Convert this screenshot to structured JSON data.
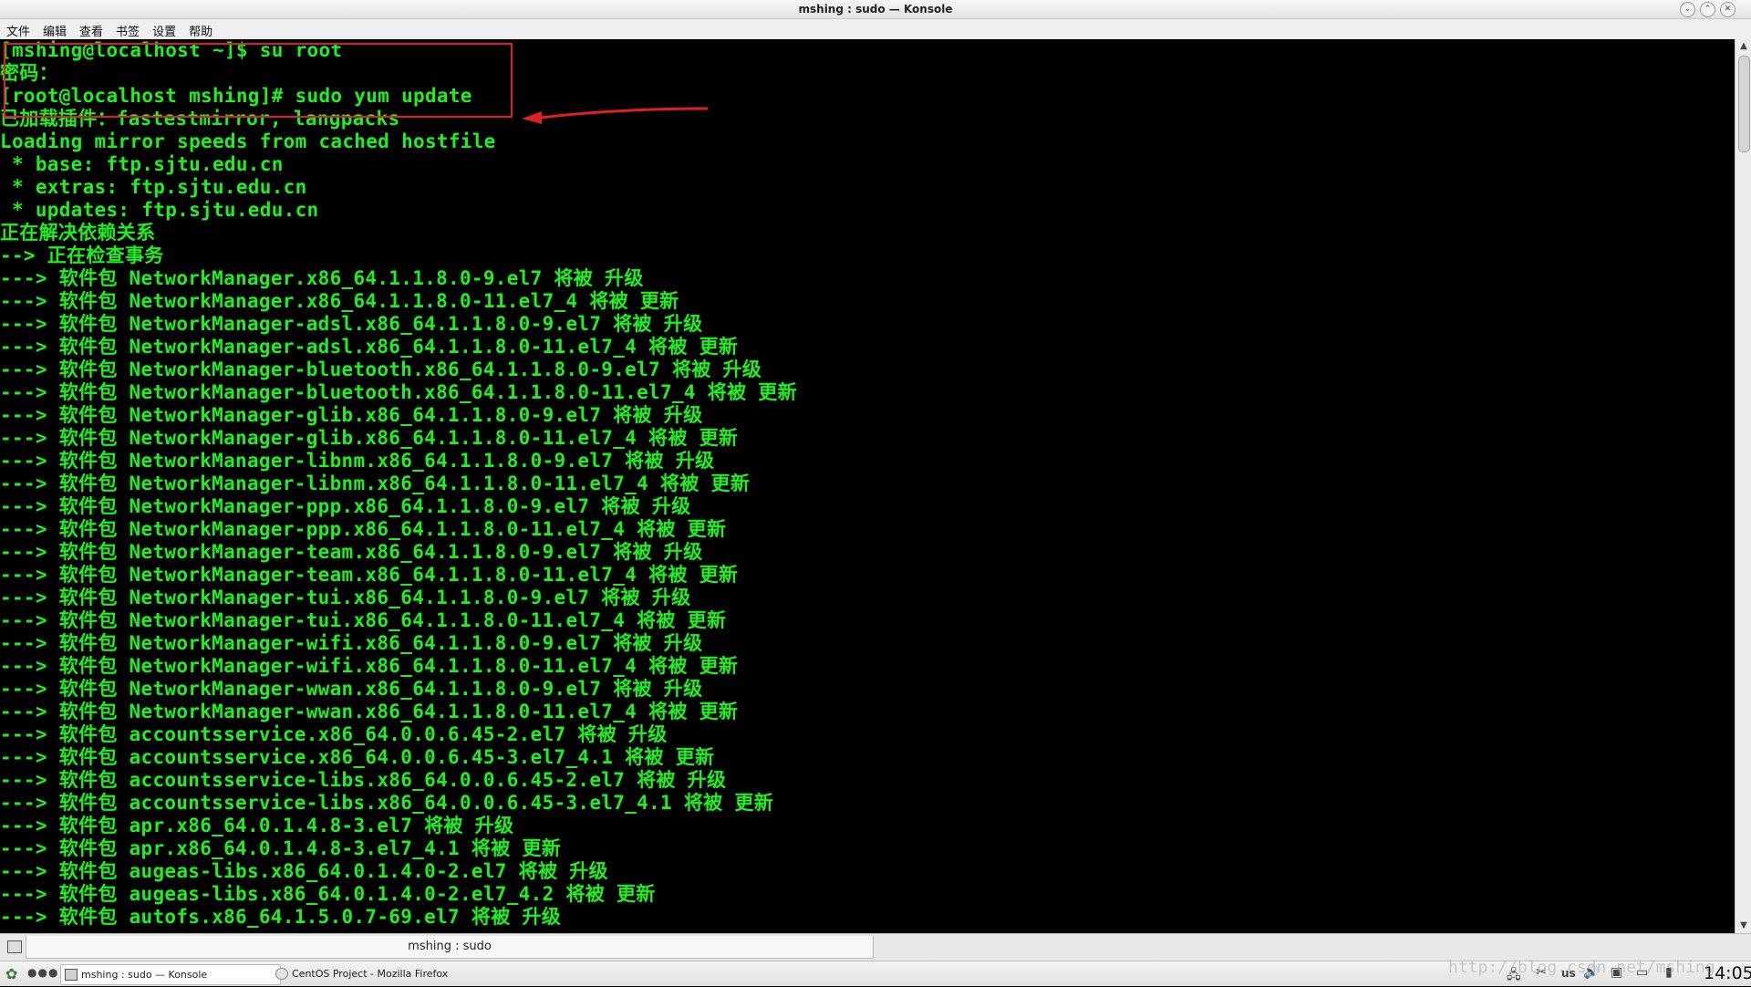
{
  "window": {
    "title": "mshing : sudo — Konsole",
    "buttons": {
      "minimize": "⌄",
      "maximize": "⌃",
      "close": "✕"
    }
  },
  "menu": [
    "文件",
    "编辑",
    "查看",
    "书签",
    "设置",
    "帮助"
  ],
  "terminal": {
    "lines": [
      "[mshing@localhost ~]$ su root",
      "密码：",
      "[root@localhost mshing]# sudo yum update",
      "已加载插件：fastestmirror, langpacks",
      "Loading mirror speeds from cached hostfile",
      " * base: ftp.sjtu.edu.cn",
      " * extras: ftp.sjtu.edu.cn",
      " * updates: ftp.sjtu.edu.cn",
      "正在解决依赖关系",
      "--> 正在检查事务",
      "---> 软件包 NetworkManager.x86_64.1.1.8.0-9.el7 将被 升级",
      "---> 软件包 NetworkManager.x86_64.1.1.8.0-11.el7_4 将被 更新",
      "---> 软件包 NetworkManager-adsl.x86_64.1.1.8.0-9.el7 将被 升级",
      "---> 软件包 NetworkManager-adsl.x86_64.1.1.8.0-11.el7_4 将被 更新",
      "---> 软件包 NetworkManager-bluetooth.x86_64.1.1.8.0-9.el7 将被 升级",
      "---> 软件包 NetworkManager-bluetooth.x86_64.1.1.8.0-11.el7_4 将被 更新",
      "---> 软件包 NetworkManager-glib.x86_64.1.1.8.0-9.el7 将被 升级",
      "---> 软件包 NetworkManager-glib.x86_64.1.1.8.0-11.el7_4 将被 更新",
      "---> 软件包 NetworkManager-libnm.x86_64.1.1.8.0-9.el7 将被 升级",
      "---> 软件包 NetworkManager-libnm.x86_64.1.1.8.0-11.el7_4 将被 更新",
      "---> 软件包 NetworkManager-ppp.x86_64.1.1.8.0-9.el7 将被 升级",
      "---> 软件包 NetworkManager-ppp.x86_64.1.1.8.0-11.el7_4 将被 更新",
      "---> 软件包 NetworkManager-team.x86_64.1.1.8.0-9.el7 将被 升级",
      "---> 软件包 NetworkManager-team.x86_64.1.1.8.0-11.el7_4 将被 更新",
      "---> 软件包 NetworkManager-tui.x86_64.1.1.8.0-9.el7 将被 升级",
      "---> 软件包 NetworkManager-tui.x86_64.1.1.8.0-11.el7_4 将被 更新",
      "---> 软件包 NetworkManager-wifi.x86_64.1.1.8.0-9.el7 将被 升级",
      "---> 软件包 NetworkManager-wifi.x86_64.1.1.8.0-11.el7_4 将被 更新",
      "---> 软件包 NetworkManager-wwan.x86_64.1.1.8.0-9.el7 将被 升级",
      "---> 软件包 NetworkManager-wwan.x86_64.1.1.8.0-11.el7_4 将被 更新",
      "---> 软件包 accountsservice.x86_64.0.0.6.45-2.el7 将被 升级",
      "---> 软件包 accountsservice.x86_64.0.0.6.45-3.el7_4.1 将被 更新",
      "---> 软件包 accountsservice-libs.x86_64.0.0.6.45-2.el7 将被 升级",
      "---> 软件包 accountsservice-libs.x86_64.0.0.6.45-3.el7_4.1 将被 更新",
      "---> 软件包 apr.x86_64.0.1.4.8-3.el7 将被 升级",
      "---> 软件包 apr.x86_64.0.1.4.8-3.el7_4.1 将被 更新",
      "---> 软件包 augeas-libs.x86_64.0.1.4.0-2.el7 将被 升级",
      "---> 软件包 augeas-libs.x86_64.0.1.4.0-2.el7_4.2 将被 更新",
      "---> 软件包 autofs.x86_64.1.5.0.7-69.el7 将被 升级"
    ]
  },
  "tabs": [
    {
      "label": "mshing : sudo"
    }
  ],
  "taskbar": {
    "tasks": [
      {
        "label": "mshing : sudo — Konsole",
        "active": true
      },
      {
        "label": "CentOS Project - Mozilla Firefox",
        "active": false
      }
    ],
    "tray": {
      "keyboard_layout": "us"
    },
    "clock": "14:05"
  },
  "watermark": "http://blog.csdn.net/mshing",
  "colors": {
    "terminal_text": "#1ef01e",
    "terminal_bg": "#000000",
    "annotation": "#e02020"
  }
}
